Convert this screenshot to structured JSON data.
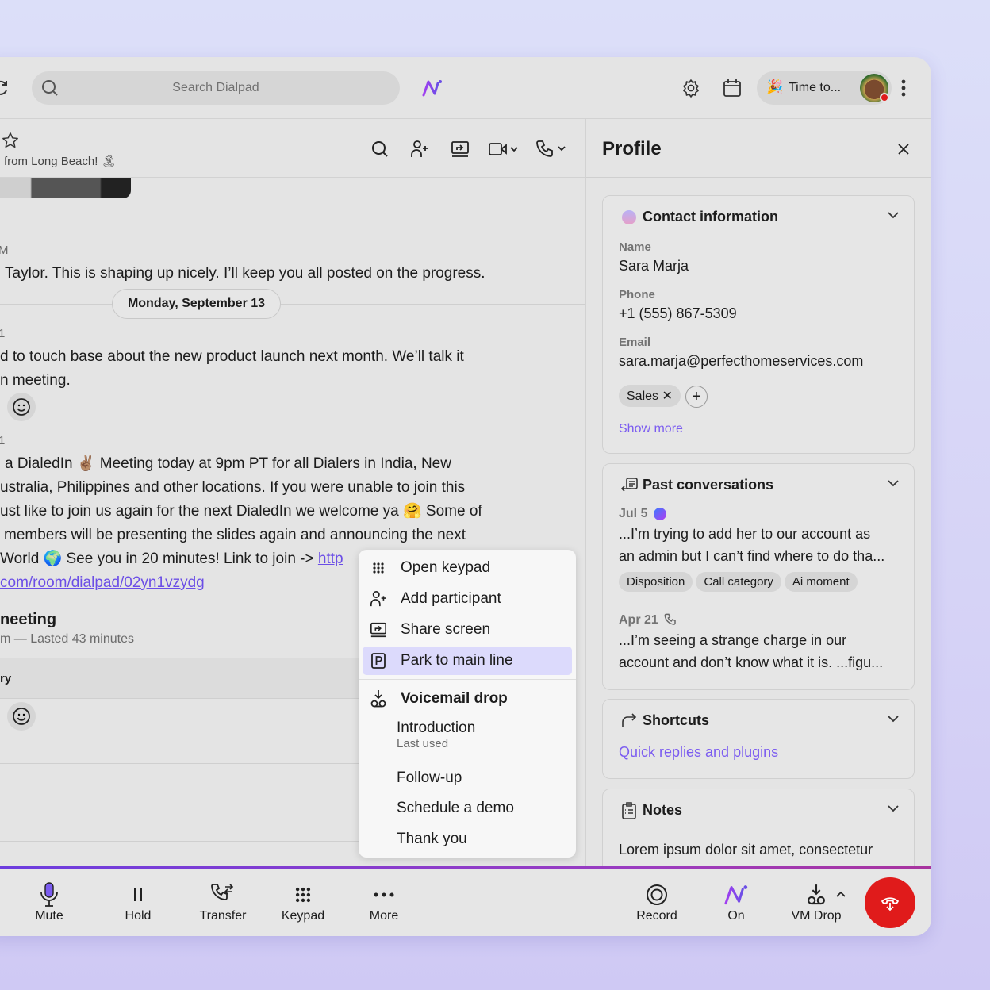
{
  "topbar": {
    "search_placeholder": "Search Dialpad",
    "status": "Time to..."
  },
  "chat": {
    "header_subtitle": "from Long Beach!",
    "msg1_time": "M",
    "msg1": "Taylor. This is shaping up nicely. I’ll keep you all posted on the progress.",
    "date_divider": "Monday, September 13",
    "msg2_time": "1",
    "msg2_lines": [
      "d to touch base about the new product launch next month. We’ll talk it",
      "n meeting."
    ],
    "msg3_time": "1",
    "msg3_lines": [
      "a DialedIn ✌🏽 Meeting today at 9pm PT for all Dialers in India, New",
      "ustralia, Philippines and other locations.  If you were unable to join this",
      "ust like to join us again for the next DialedIn we welcome ya 🤗 Some of",
      "members will be presenting the slides again and announcing the next",
      "World 🌍 See you in 20 minutes! Link to join -> "
    ],
    "msg3_link_start": "http",
    "msg3_link_end": "com/room/dialpad/02yn1vzydg",
    "meeting_title": "neeting",
    "meeting_sub": "m — Lasted 43 minutes",
    "summary_label": "ry"
  },
  "menu": {
    "items": [
      {
        "label": "Open keypad",
        "icon": "keypad-icon"
      },
      {
        "label": "Add participant",
        "icon": "add-person-icon"
      },
      {
        "label": "Share screen",
        "icon": "share-screen-icon"
      },
      {
        "label": "Park to main line",
        "icon": "park-icon",
        "highlighted": true
      }
    ],
    "vm_header": "Voicemail drop",
    "vm_items": [
      {
        "label": "Introduction",
        "sub": "Last used"
      },
      {
        "label": "Follow-up"
      },
      {
        "label": "Schedule a demo"
      },
      {
        "label": "Thank you"
      }
    ]
  },
  "profile": {
    "title": "Profile",
    "contact": {
      "title": "Contact information",
      "name_label": "Name",
      "name": "Sara Marja",
      "phone_label": "Phone",
      "phone": "+1 (555) 867-5309",
      "email_label": "Email",
      "email": "sara.marja@perfecthomeservices.com",
      "tag": "Sales",
      "show_more": "Show more"
    },
    "past": {
      "title": "Past conversations",
      "c1_date": "Jul 5",
      "c1_text": [
        "...I’m trying to add her to our account as",
        "an admin but I can’t find where to do tha..."
      ],
      "chips": [
        "Disposition",
        "Call category",
        "Ai moment"
      ],
      "c2_date": "Apr 21",
      "c2_text": [
        "...I’m seeing a strange charge in our",
        "account and don’t know what it is. ...figu..."
      ]
    },
    "shortcuts": {
      "title": "Shortcuts",
      "link": "Quick replies and plugins"
    },
    "notes": {
      "title": "Notes",
      "text": "Lorem ipsum dolor sit amet, consectetur"
    }
  },
  "callbar": {
    "mute": "Mute",
    "hold": "Hold",
    "transfer": "Transfer",
    "keypad": "Keypad",
    "more": "More",
    "record": "Record",
    "ai": "On",
    "vmdrop": "VM Drop"
  },
  "colors": {
    "accent": "#7b5cf0",
    "hangup": "#e01b1b",
    "ai_gradient": [
      "#a13ef0",
      "#6b4ee6"
    ]
  }
}
